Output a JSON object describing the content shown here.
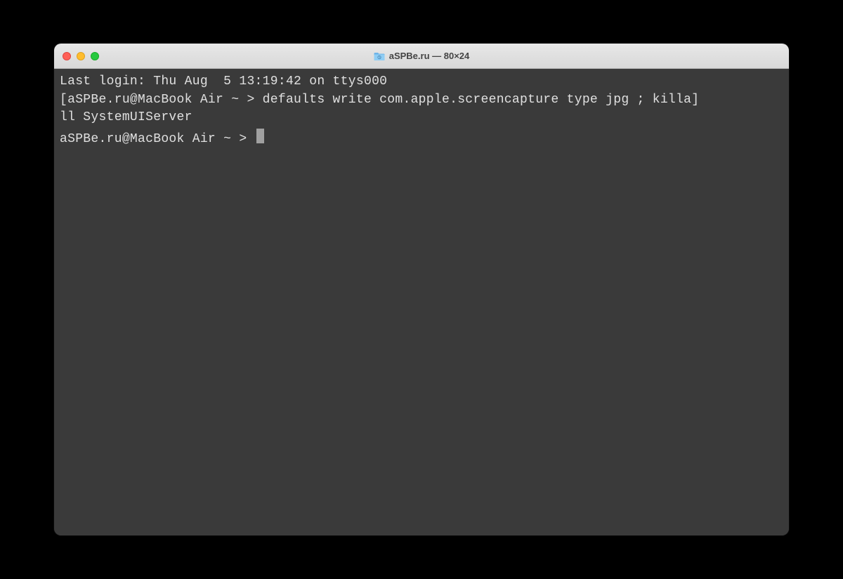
{
  "window": {
    "title": "aSPBe.ru — 80×24"
  },
  "terminal": {
    "line1": "Last login: Thu Aug  5 13:19:42 on ttys000",
    "line2": "[aSPBe.ru@MacBook Air ~ > defaults write com.apple.screencapture type jpg ; killa]",
    "line3": "ll SystemUIServer",
    "prompt": "aSPBe.ru@MacBook Air ~ > "
  }
}
